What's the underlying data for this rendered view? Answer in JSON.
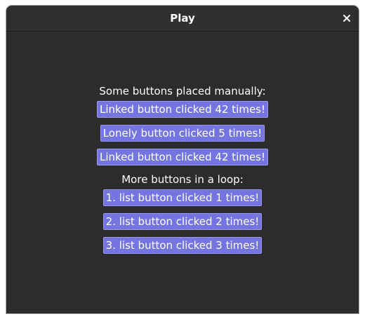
{
  "window": {
    "title": "Play"
  },
  "icons": {
    "close": "close-icon"
  },
  "colors": {
    "window_background": "#2c2c2c",
    "titlebar_background": "#303030",
    "button_background": "#7575e2",
    "text": "#ffffff"
  },
  "manual_section": {
    "heading": "Some buttons placed manually:",
    "linked_button_1": "Linked button clicked 42 times!",
    "lonely_button": "Lonely button clicked 5 times!",
    "linked_button_2": "Linked button clicked 42 times!"
  },
  "loop_section": {
    "heading": "More buttons in a loop:",
    "buttons": [
      "1. list button clicked 1 times!",
      "2. list button clicked 2 times!",
      "3. list button clicked 3 times!"
    ]
  }
}
